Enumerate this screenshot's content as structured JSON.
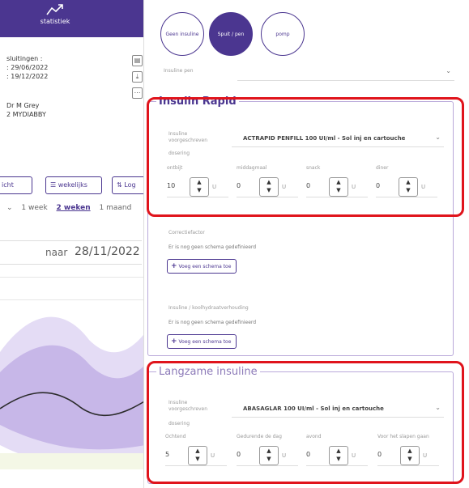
{
  "left": {
    "stats_tab": "statistiek",
    "info1": [
      "sluitingen :",
      ": 29/06/2022",
      ": 19/12/2022"
    ],
    "info2": [
      "Dr M Grey",
      "2 MYDIABBY"
    ],
    "buttons": [
      "icht",
      "wekelijks",
      "Log"
    ],
    "periods": [
      "1 week",
      "2 weken",
      "1 maand"
    ],
    "active_period": "2 weken",
    "date_naar": "naar",
    "date_value": "28/11/2022"
  },
  "panel": {
    "segments": [
      "Geen insuline",
      "Spuit / pen",
      "pomp"
    ],
    "active_segment": "Spuit / pen",
    "insuline_pen_label": "Insuline pen",
    "rapid": {
      "legend": "Insulin Rapid",
      "prescribed_label": "Insuline voorgeschreven",
      "prescribed_value": "ACTRAPID PENFILL 100 UI/ml - Sol inj en cartouche",
      "dosering": "dosering",
      "fields": [
        {
          "label": "ontbijt",
          "value": "10",
          "unit": "U"
        },
        {
          "label": "middagmaal",
          "value": "0",
          "unit": "U"
        },
        {
          "label": "snack",
          "value": "0",
          "unit": "U"
        },
        {
          "label": "diner",
          "value": "0",
          "unit": "U"
        }
      ],
      "correctie_label": "Correctiefactor",
      "correctie_text": "Er is nog geen schema gedefinieerd",
      "correctie_button": "Voeg een schema toe",
      "ratio_label": "Insuline / koolhydraatverhouding",
      "ratio_text": "Er is nog geen schema gedefinieerd",
      "ratio_button": "Voeg een schema toe"
    },
    "slow": {
      "legend": "Langzame insuline",
      "prescribed_label": "Insuline voorgeschreven",
      "prescribed_value": "ABASAGLAR 100 UI/ml - Sol inj en cartouche",
      "dosering": "dosering",
      "fields": [
        {
          "label": "Ochtend",
          "value": "5",
          "unit": "U"
        },
        {
          "label": "Gedurende de dag",
          "value": "0",
          "unit": "U"
        },
        {
          "label": "avond",
          "value": "0",
          "unit": "U"
        },
        {
          "label": "Voor het slapen gaan",
          "value": "0",
          "unit": "U"
        }
      ]
    }
  },
  "colors": {
    "brand": "#4b3690",
    "highlight": "#e0141c",
    "chart_light": "#d9cff0",
    "chart_mid": "#b8a6e0"
  }
}
